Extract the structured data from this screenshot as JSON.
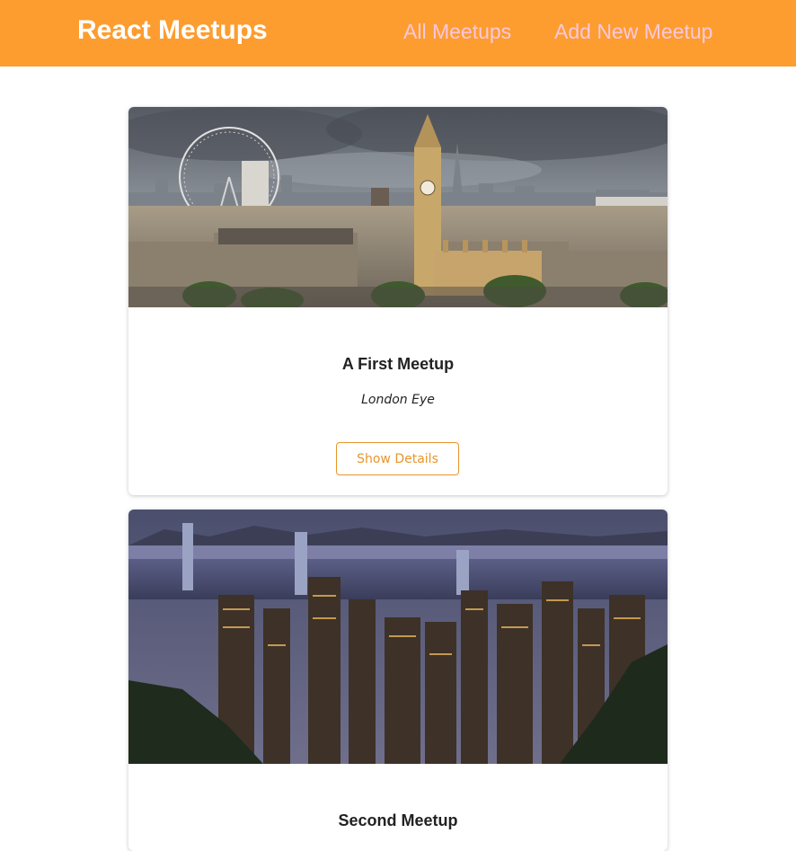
{
  "header": {
    "logo": "React Meetups",
    "nav": [
      "All Meetups",
      "Add New Meetup"
    ]
  },
  "colors": {
    "header_bg": "#fd9d2f",
    "nav_link": "#fcc7de",
    "button_accent": "#e8952c"
  },
  "meetups": [
    {
      "title": "A First Meetup",
      "address": "London Eye",
      "button_label": "Show Details",
      "image": "london-skyline-photo"
    },
    {
      "title": "Second Meetup",
      "image": "hong-kong-night-skyline-photo"
    }
  ]
}
